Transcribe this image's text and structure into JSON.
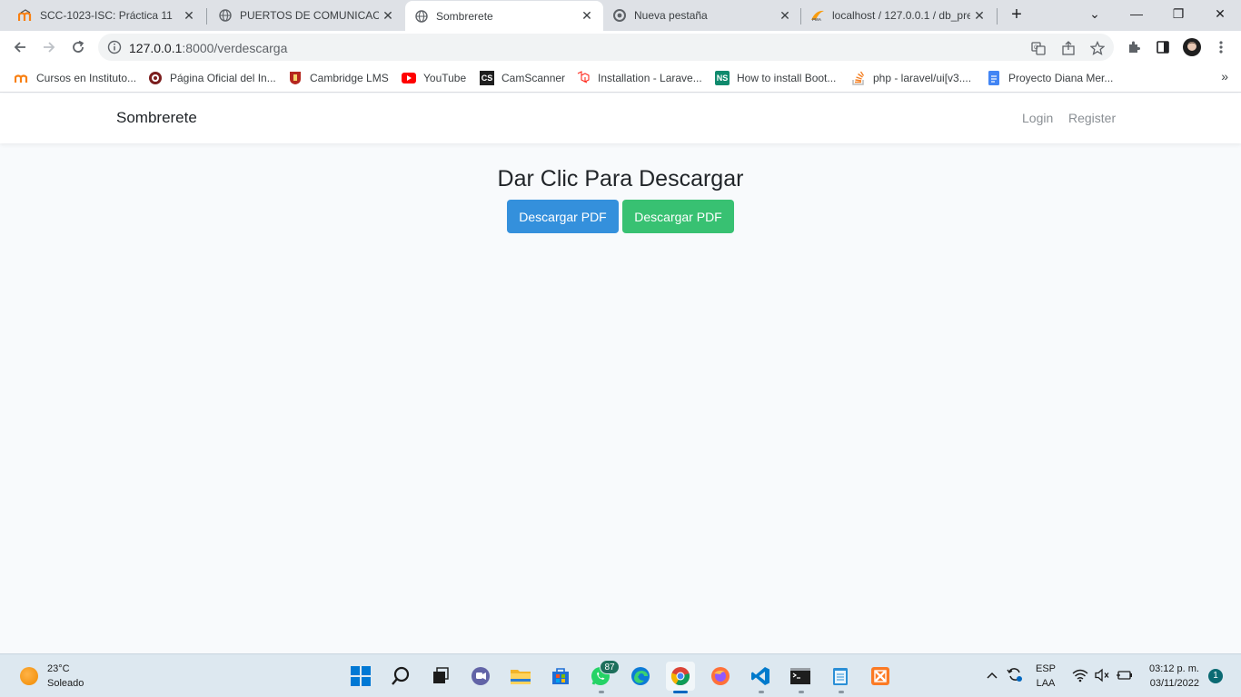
{
  "browser": {
    "tabs": [
      {
        "title": "SCC-1023-ISC: Práctica 11",
        "icon": "moodle-icon"
      },
      {
        "title": "PUERTOS DE COMUNICACIÓN",
        "icon": "globe-icon"
      },
      {
        "title": "Sombrerete",
        "icon": "globe-icon",
        "active": true
      },
      {
        "title": "Nueva pestaña",
        "icon": "chrome-icon"
      },
      {
        "title": "localhost / 127.0.0.1 / db_pre",
        "icon": "phpmyadmin-icon"
      }
    ],
    "close_glyph": "✕",
    "new_tab_glyph": "+",
    "window_controls": {
      "tab_search": "⌄",
      "minimize": "—",
      "maximize": "❐",
      "close": "✕"
    },
    "address": {
      "host": "127.0.0.1",
      "path": ":8000/verdescarga"
    },
    "bookmarks": [
      {
        "label": "Cursos en Instituto...",
        "icon": "moodle-icon"
      },
      {
        "label": "Página Oficial del In...",
        "icon": "institute-icon"
      },
      {
        "label": "Cambridge LMS",
        "icon": "cambridge-icon"
      },
      {
        "label": "YouTube",
        "icon": "youtube-icon"
      },
      {
        "label": "CamScanner",
        "icon": "camscanner-icon",
        "badge": "CS"
      },
      {
        "label": "Installation - Larave...",
        "icon": "laravel-icon"
      },
      {
        "label": "How to install Boot...",
        "icon": "ns-icon",
        "badge": "NS"
      },
      {
        "label": "php - laravel/ui[v3....",
        "icon": "stackoverflow-icon"
      },
      {
        "label": "Proyecto Diana Mer...",
        "icon": "docs-icon"
      }
    ],
    "bookmarks_more": "»"
  },
  "page": {
    "brand": "Sombrerete",
    "nav": {
      "login": "Login",
      "register": "Register"
    },
    "heading": "Dar Clic Para Descargar",
    "buttons": {
      "first": "Descargar PDF",
      "second": "Descargar PDF"
    },
    "colors": {
      "primary": "#3490dc",
      "success": "#38c172"
    }
  },
  "taskbar": {
    "weather": {
      "temp": "23°C",
      "desc": "Soleado"
    },
    "whatsapp_badge": "87",
    "language": {
      "line1": "ESP",
      "line2": "LAA"
    },
    "clock": {
      "time": "03:12 p. m.",
      "date": "03/11/2022"
    },
    "notifications": "1"
  }
}
